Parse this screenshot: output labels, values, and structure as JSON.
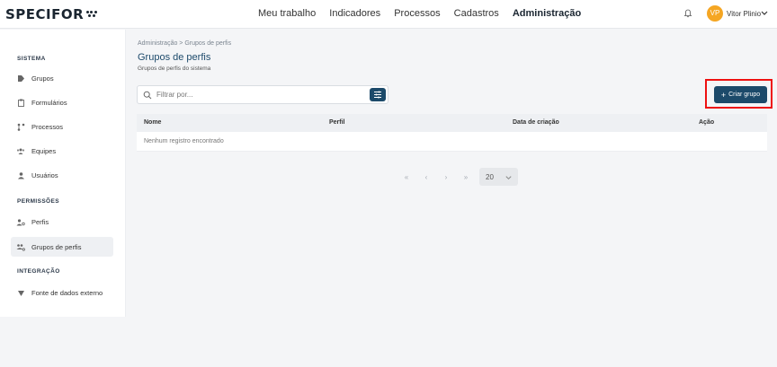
{
  "header": {
    "logo": "SPECIFOR",
    "nav": [
      "Meu trabalho",
      "Indicadores",
      "Processos",
      "Cadastros",
      "Administração"
    ],
    "active_nav": "Administração",
    "user_initials": "VP",
    "user_name": "Vitor Plinio"
  },
  "sidebar": {
    "sections": [
      {
        "title": "SISTEMA",
        "items": [
          {
            "label": "Grupos",
            "icon": "tag-icon"
          },
          {
            "label": "Formulários",
            "icon": "clipboard-icon"
          },
          {
            "label": "Processos",
            "icon": "flow-icon"
          },
          {
            "label": "Equipes",
            "icon": "team-icon"
          },
          {
            "label": "Usuários",
            "icon": "user-icon"
          }
        ]
      },
      {
        "title": "PERMISSÕES",
        "items": [
          {
            "label": "Perfis",
            "icon": "profile-icon"
          },
          {
            "label": "Grupos de perfis",
            "icon": "profile-group-icon",
            "active": true
          }
        ]
      },
      {
        "title": "INTEGRAÇÃO",
        "items": [
          {
            "label": "Fonte de dados externo",
            "icon": "data-source-icon"
          }
        ]
      }
    ]
  },
  "main": {
    "breadcrumb": "Administração  >  Grupos de perfis",
    "title": "Grupos de perfis",
    "subtitle": "Grupos de perfis do sistema",
    "search_placeholder": "Filtrar por...",
    "create_button": "Criar grupo",
    "table": {
      "columns": [
        "Nome",
        "Perfil",
        "Data de criação",
        "Ação"
      ],
      "empty_message": "Nenhum registro encontrado"
    },
    "pager": {
      "first": "«",
      "prev": "‹",
      "next": "›",
      "last": "»",
      "page_size": "20"
    }
  },
  "colors": {
    "primary": "#1c4a6a",
    "avatar": "#f5a623",
    "highlight": "#e11111"
  }
}
